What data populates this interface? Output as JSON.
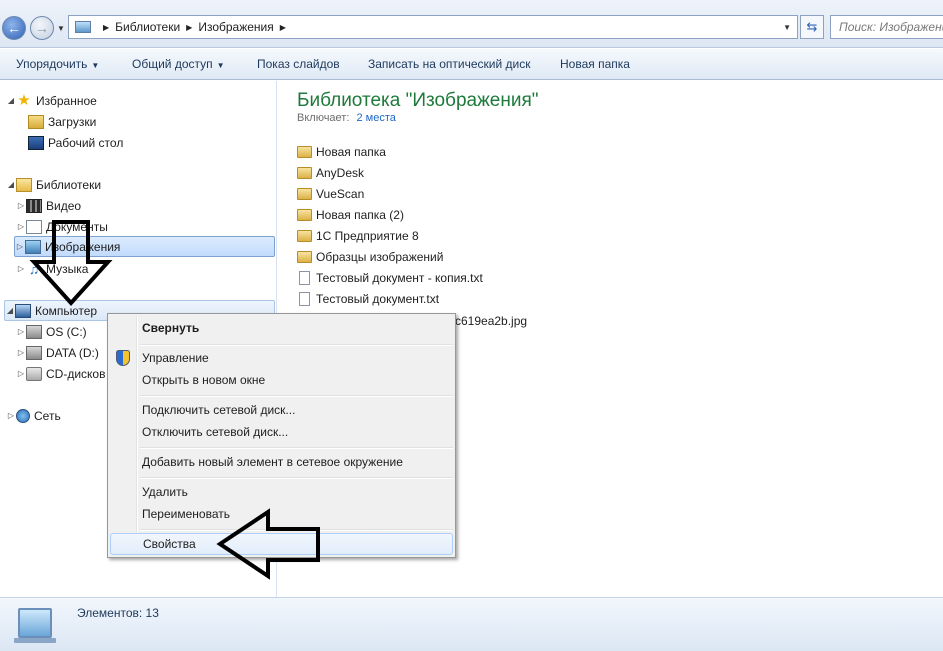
{
  "address": {
    "breadcrumbs": [
      "Библиотеки",
      "Изображения"
    ],
    "search_placeholder": "Поиск: Изображения"
  },
  "toolbar": {
    "organize": "Упорядочить",
    "share": "Общий доступ",
    "slideshow": "Показ слайдов",
    "burn": "Записать на оптический диск",
    "new_folder": "Новая папка"
  },
  "navpane": {
    "favorites": "Избранное",
    "downloads": "Загрузки",
    "desktop": "Рабочий стол",
    "libraries": "Библиотеки",
    "video": "Видео",
    "documents": "Документы",
    "images": "Изображения",
    "music": "Музыка",
    "computer": "Компьютер",
    "drive_c": "OS (C:)",
    "drive_d": "DATA (D:)",
    "cd": "CD-дисков",
    "network": "Сеть"
  },
  "content": {
    "title": "Библиотека \"Изображения\"",
    "includes_label": "Включает:",
    "includes_link": "2 места",
    "files": [
      {
        "name": "Новая папка",
        "type": "folder"
      },
      {
        "name": "AnyDesk",
        "type": "folder"
      },
      {
        "name": "VueScan",
        "type": "folder"
      },
      {
        "name": "Новая папка (2)",
        "type": "folder"
      },
      {
        "name": "1С Предприятие 8",
        "type": "folder"
      },
      {
        "name": "Образцы изображений",
        "type": "folder"
      },
      {
        "name": "Тестовый документ - копия.txt",
        "type": "txt"
      },
      {
        "name": "Тестовый документ.txt",
        "type": "txt"
      },
      {
        "name": "c619ea2b.jpg",
        "type": "jpg"
      }
    ]
  },
  "context_menu": {
    "collapse": "Свернуть",
    "manage": "Управление",
    "open_new_window": "Открыть в новом окне",
    "map_drive": "Подключить сетевой диск...",
    "disconnect_drive": "Отключить сетевой диск...",
    "add_network_location": "Добавить новый элемент в сетевое окружение",
    "delete": "Удалить",
    "rename": "Переименовать",
    "properties": "Свойства"
  },
  "status": {
    "items": "Элементов: 13"
  }
}
